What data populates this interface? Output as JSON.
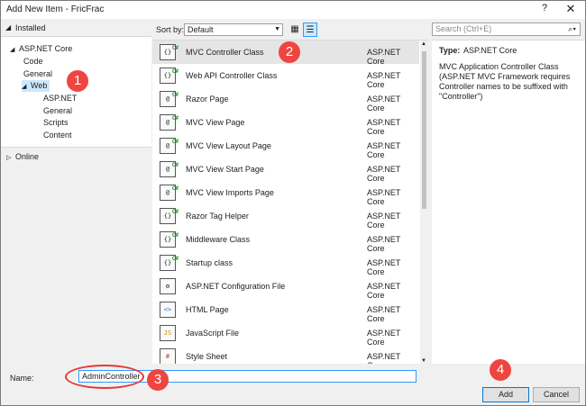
{
  "window": {
    "title": "Add New Item - FricFrac",
    "help": "?",
    "close": "✕"
  },
  "tree": {
    "header": "Installed",
    "nodes": [
      {
        "label": "ASP.NET Core",
        "tri": "◢"
      },
      {
        "label": "Code",
        "tri": ""
      },
      {
        "label": "General",
        "tri": ""
      },
      {
        "label": "Web",
        "tri": "◢"
      },
      {
        "label": "ASP.NET",
        "tri": ""
      },
      {
        "label": "General",
        "tri": ""
      },
      {
        "label": "Scripts",
        "tri": ""
      },
      {
        "label": "Content",
        "tri": ""
      }
    ],
    "online": {
      "label": "Online",
      "tri": "▷"
    }
  },
  "toolbar": {
    "sort_label": "Sort by:",
    "sort_value": "Default",
    "search_placeholder": "Search (Ctrl+E)"
  },
  "items": [
    {
      "name": "MVC Controller Class",
      "category": "ASP.NET Core",
      "icon": "controller-icon"
    },
    {
      "name": "Web API Controller Class",
      "category": "ASP.NET Core",
      "icon": "controller-icon"
    },
    {
      "name": "Razor Page",
      "category": "ASP.NET Core",
      "icon": "page-icon"
    },
    {
      "name": "MVC View Page",
      "category": "ASP.NET Core",
      "icon": "page-icon"
    },
    {
      "name": "MVC View Layout Page",
      "category": "ASP.NET Core",
      "icon": "page-icon"
    },
    {
      "name": "MVC View Start Page",
      "category": "ASP.NET Core",
      "icon": "page-icon"
    },
    {
      "name": "MVC View Imports Page",
      "category": "ASP.NET Core",
      "icon": "page-icon"
    },
    {
      "name": "Razor Tag Helper",
      "category": "ASP.NET Core",
      "icon": "controller-icon"
    },
    {
      "name": "Middleware Class",
      "category": "ASP.NET Core",
      "icon": "controller-icon"
    },
    {
      "name": "Startup class",
      "category": "ASP.NET Core",
      "icon": "controller-icon"
    },
    {
      "name": "ASP.NET Configuration File",
      "category": "ASP.NET Core",
      "icon": "config-icon"
    },
    {
      "name": "HTML Page",
      "category": "ASP.NET Core",
      "icon": "html-icon"
    },
    {
      "name": "JavaScript File",
      "category": "ASP.NET Core",
      "icon": "js-icon"
    },
    {
      "name": "Style Sheet",
      "category": "ASP.NET Core",
      "icon": "css-icon"
    }
  ],
  "details": {
    "type_label": "Type:",
    "type_value": "ASP.NET Core",
    "description": "MVC Application Controller Class (ASP.NET MVC Framework requires Controller names to be suffixed with \"Controller\")"
  },
  "footer": {
    "name_label": "Name:",
    "name_value": "AdminController",
    "add_label": "Add",
    "cancel_label": "Cancel"
  },
  "annotations": [
    "1",
    "2",
    "3",
    "4"
  ],
  "colors": {
    "callout": "#ee4540",
    "accent": "#0078d7",
    "selected_row": "#e5e5e5"
  }
}
